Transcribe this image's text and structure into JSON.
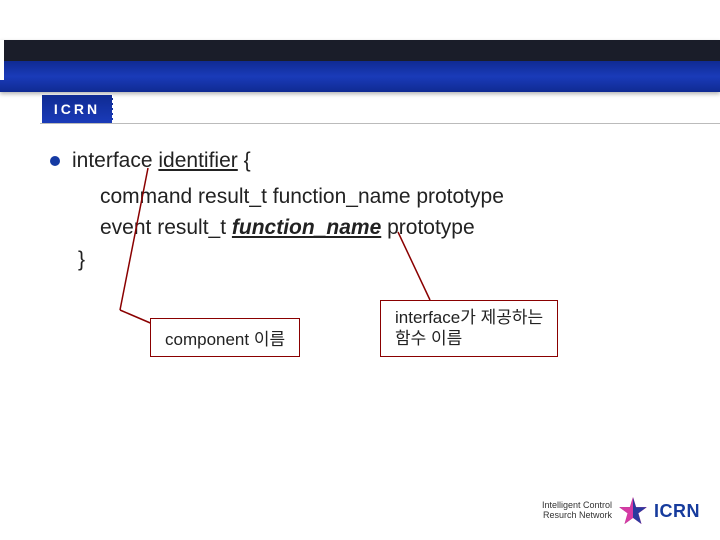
{
  "header": {
    "tab": "ICRN"
  },
  "content": {
    "bullet": "interface",
    "identifier": "identifier",
    "brace_open": "{",
    "line1": "command result_t function_name prototype",
    "line2_prefix": "event result_t ",
    "line2_emph": "function_name",
    "line2_suffix": " prototype",
    "brace_close": "}"
  },
  "callouts": {
    "left": "component 이름",
    "right_l1": "interface가 제공하는",
    "right_l2": "함수 이름"
  },
  "footer": {
    "line1": "Intelligent Control",
    "line2": "Resurch Network",
    "brand": "ICRN"
  }
}
